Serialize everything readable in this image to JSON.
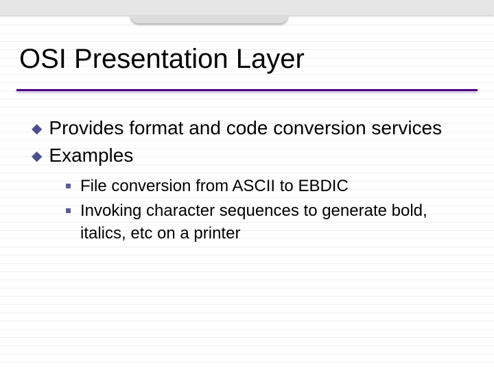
{
  "title": "OSI Presentation Layer",
  "bullets": [
    {
      "text": "Provides format and code conversion services"
    },
    {
      "text": "Examples"
    }
  ],
  "subbullets": [
    {
      "text": "File conversion from ASCII to EBDIC"
    },
    {
      "text": "Invoking character sequences to generate bold, italics, etc on a printer"
    }
  ]
}
